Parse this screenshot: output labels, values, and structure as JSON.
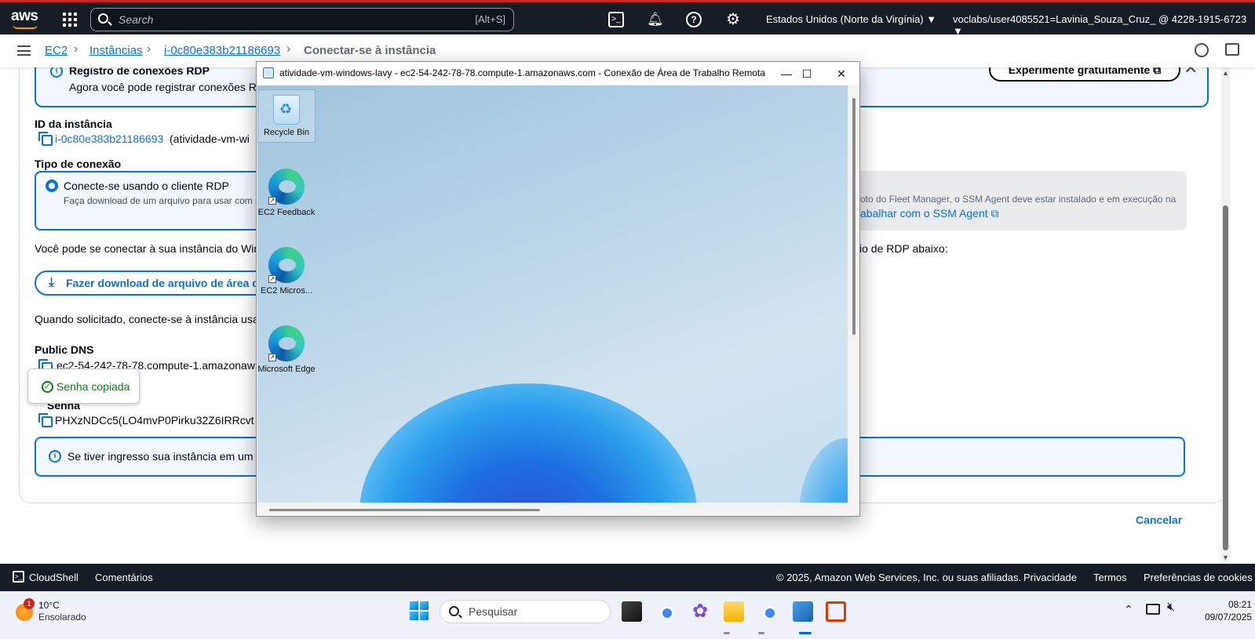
{
  "aws_nav": {
    "logo": "aws",
    "search_placeholder": "Search",
    "search_shortcut": "[Alt+S]",
    "region": "Estados Unidos (Norte da Virgínia) ▼",
    "account": "voclabs/user4085521=Lavinia_Souza_Cruz_ @ 4228-1915-6723 ▼",
    "icons": [
      "cloudshell-icon",
      "bell-icon",
      "help-icon",
      "settings-icon"
    ]
  },
  "breadcrumb": {
    "items": [
      "EC2",
      "Instâncias",
      "i-0c80e383b21186693"
    ],
    "current": "Conectar-se à instância"
  },
  "page": {
    "notice_title": "Registro de conexões RDP",
    "notice_text": "Agora você pode registrar conexões RD",
    "try_free": "Experimente gratuitamente",
    "instance_id_label": "ID da instância",
    "instance_id": "i-0c80e383b21186693",
    "instance_name": "(atividade-vm-wi",
    "conn_type_label": "Tipo de conexão",
    "rdp_option_title": "Conecte-se usando o cliente RDP",
    "rdp_option_desc": "Faça download de um arquivo para usar com s",
    "fleet_text": "oto do Fleet Manager, o SSM Agent deve estar instalado e em execução na",
    "fleet_link": "abalhar com o SSM Agent",
    "connect_text_left": "Você pode se conectar à sua instância do Win",
    "connect_text_right": "io de RDP abaixo:",
    "download_btn": "Fazer download de arquivo de área d",
    "prompt_text": "Quando solicitado, conecte-se à instância usa",
    "public_dns_label": "Public DNS",
    "public_dns": "ec2-54-242-78-78.compute-1.amazonaw",
    "password_label": "Senha",
    "password": "PHXzNDCc5(LO4mvP0Pirku32Z6IRRcvt",
    "ingress_text": "Se tiver ingresso sua instância em um c",
    "cancel": "Cancelar",
    "toast": "Senha copiada"
  },
  "aws_footer": {
    "cloudshell": "CloudShell",
    "feedback": "Comentários",
    "copyright": "© 2025, Amazon Web Services, Inc. ou suas afiliadas.",
    "privacy": "Privacidade",
    "terms": "Termos",
    "cookies": "Preferências de cookies"
  },
  "rdp_window": {
    "title": "atividade-vm-windows-lavy - ec2-54-242-78-78.compute-1.amazonaws.com - Conexão de Área de Trabalho Remota",
    "controls": [
      "—",
      "☐",
      "✕"
    ],
    "desktop_icons": [
      "Recycle Bin",
      "EC2 Feedback",
      "EC2 Micros...",
      "Microsoft Edge"
    ]
  },
  "taskbar": {
    "weather_temp": "10°C",
    "weather_desc": "Ensolarado",
    "weather_badge": "1",
    "search": "Pesquisar",
    "time": "08:21",
    "date": "09/07/2025"
  },
  "colors": {
    "aws_nav_bg": "#161d26",
    "link_blue": "#0972d3",
    "success_green": "#037f0c",
    "accent_orange": "#ff9900"
  }
}
